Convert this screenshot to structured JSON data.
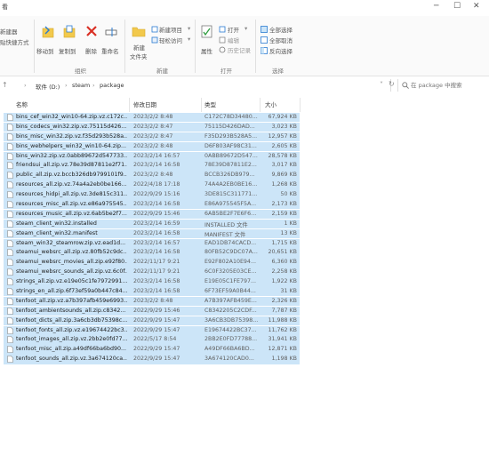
{
  "window": {
    "title": "看"
  },
  "ribbon": {
    "clipboard_new": "新建器",
    "clipboard_paste_shortcut": "贴快捷方式",
    "organize": {
      "move_to": "移动到",
      "copy_to": "复制到",
      "delete": "删除",
      "rename": "重命名",
      "group_label": "组织"
    },
    "new": {
      "new_folder_line1": "新建",
      "new_folder_line2": "文件夹",
      "new_item": "新建项目",
      "easy_access": "轻松访问",
      "group_label": "新建"
    },
    "open": {
      "properties": "属性",
      "open": "打开",
      "edit": "编辑",
      "history": "历史记录",
      "group_label": "打开"
    },
    "select": {
      "select_all": "全部选择",
      "select_none": "全部取消",
      "invert": "反向选择",
      "group_label": "选择"
    }
  },
  "address": {
    "drive": "软件 (D:)",
    "folder1": "steam",
    "folder2": "package",
    "search_placeholder": "在 package 中搜索"
  },
  "columns": {
    "name": "名称",
    "date": "修改日期",
    "type": "类型",
    "size": "大小"
  },
  "files": [
    {
      "name": "bins_cef_win32_win10-64.zip.vz.c172c...",
      "date": "2023/2/2 8:48",
      "type": "C172C78D34480...",
      "size": "67,924 KB"
    },
    {
      "name": "bins_codecs_win32.zip.vz.75115d426...",
      "date": "2023/2/2 8:47",
      "type": "75115D426DAD...",
      "size": "3,023 KB"
    },
    {
      "name": "bins_misc_win32.zip.vz.f35d293b528a...",
      "date": "2023/2/2 8:47",
      "type": "F35D293B528A5...",
      "size": "12,957 KB"
    },
    {
      "name": "bins_webhelpers_win32_win10-64.zip...",
      "date": "2023/2/2 8:48",
      "type": "D6F803AF98C31...",
      "size": "2,605 KB"
    },
    {
      "name": "bins_win32.zip.vz.0abb89672d547733...",
      "date": "2023/2/14 16:57",
      "type": "0ABB89672D547...",
      "size": "28,578 KB"
    },
    {
      "name": "friendsui_all.zip.vz.78e39d87811e2f71...",
      "date": "2023/2/14 16:58",
      "type": "78E39D87811E2...",
      "size": "3,017 KB"
    },
    {
      "name": "public_all.zip.vz.bccb326db9799101f9...",
      "date": "2023/2/2 8:48",
      "type": "BCCB326DB979...",
      "size": "9,869 KB"
    },
    {
      "name": "resources_all.zip.vz.74a4a2eb0be166...",
      "date": "2022/4/18 17:18",
      "type": "74A4A2EB0BE16...",
      "size": "1,268 KB"
    },
    {
      "name": "resources_hidpi_all.zip.vz.3de815c311...",
      "date": "2022/9/29 15:16",
      "type": "3DE815C311771...",
      "size": "50 KB"
    },
    {
      "name": "resources_misc_all.zip.vz.e86a975545...",
      "date": "2023/2/14 16:58",
      "type": "E86A975545F5A...",
      "size": "2,173 KB"
    },
    {
      "name": "resources_music_all.zip.vz.6ab5be2f7...",
      "date": "2022/9/29 15:46",
      "type": "6AB5BE2F7E6F6...",
      "size": "2,159 KB"
    },
    {
      "name": "steam_client_win32.installed",
      "date": "2023/2/14 16:59",
      "type": "INSTALLED 文件",
      "size": "1 KB"
    },
    {
      "name": "steam_client_win32.manifest",
      "date": "2023/2/14 16:58",
      "type": "MANIFEST 文件",
      "size": "13 KB"
    },
    {
      "name": "steam_win32_steamrow.zip.vz.ead1d...",
      "date": "2023/2/14 16:57",
      "type": "EAD1DB74CACD...",
      "size": "1,715 KB"
    },
    {
      "name": "steamui_websrc_all.zip.vz.80fb52c9dc...",
      "date": "2023/2/14 16:58",
      "type": "80FB52C9DC07A...",
      "size": "20,651 KB"
    },
    {
      "name": "steamui_websrc_movies_all.zip.e92f80...",
      "date": "2022/11/17 9:21",
      "type": "E92F802A10E94...",
      "size": "6,360 KB"
    },
    {
      "name": "steamui_websrc_sounds_all.zip.vz.6c0f...",
      "date": "2022/11/17 9:21",
      "type": "6C0F3205E03CE...",
      "size": "2,258 KB"
    },
    {
      "name": "strings_all.zip.vz.e19e05c1fe7972991...",
      "date": "2023/2/14 16:58",
      "type": "E19E05C1FE797...",
      "size": "1,922 KB"
    },
    {
      "name": "strings_en_all.zip.6f73ef59a0b447c84...",
      "date": "2023/2/14 16:58",
      "type": "6F73EF59A0B44...",
      "size": "31 KB"
    },
    {
      "name": "tenfoot_all.zip.vz.a7b397afb459e6993...",
      "date": "2023/2/2 8:48",
      "type": "A7B397AFB459E...",
      "size": "2,326 KB"
    },
    {
      "name": "tenfoot_ambientsounds_all.zip.c8342...",
      "date": "2022/9/29 15:46",
      "type": "C8342205C2CDF...",
      "size": "7,787 KB"
    },
    {
      "name": "tenfoot_dicts_all.zip.3a6cb3db75398c...",
      "date": "2022/9/29 15:47",
      "type": "3A6CB3DB75398...",
      "size": "11,988 KB"
    },
    {
      "name": "tenfoot_fonts_all.zip.vz.e19674422bc3...",
      "date": "2022/9/29 15:47",
      "type": "E19674422BC37...",
      "size": "11,762 KB"
    },
    {
      "name": "tenfoot_images_all.zip.vz.2bb2e0fd77...",
      "date": "2022/5/17 8:54",
      "type": "2BB2E0FD77788...",
      "size": "31,941 KB"
    },
    {
      "name": "tenfoot_misc_all.zip.a49df66ba6bd90...",
      "date": "2022/9/29 15:47",
      "type": "A49DF66BA6BD...",
      "size": "12,871 KB"
    },
    {
      "name": "tenfoot_sounds_all.zip.vz.3a674120ca...",
      "date": "2022/9/29 15:47",
      "type": "3A674120CAD0...",
      "size": "1,198 KB"
    }
  ]
}
